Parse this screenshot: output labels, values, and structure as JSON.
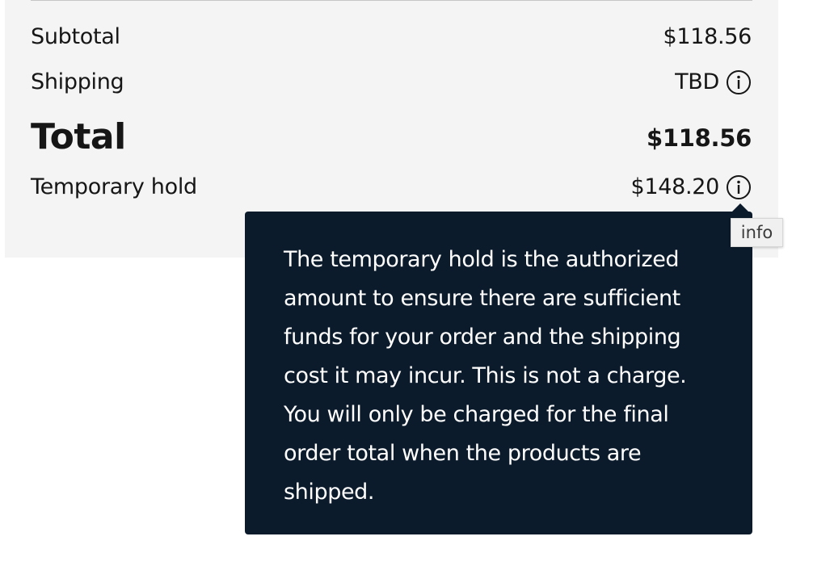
{
  "summary": {
    "subtotal_label": "Subtotal",
    "subtotal_value": "$118.56",
    "shipping_label": "Shipping",
    "shipping_value": "TBD",
    "total_label": "Total",
    "total_value": "$118.56",
    "hold_label": "Temporary hold",
    "hold_value": "$148.20"
  },
  "tooltip": {
    "lines": [
      "The temporary hold is the authorized",
      "amount to ensure there are sufficient",
      "funds for your order and the shipping",
      "cost it may incur. This is not a charge.",
      "You will only be charged for the final",
      "order total when the products are",
      "shipped."
    ]
  },
  "browser_tooltip": {
    "text": "info"
  },
  "icons": {
    "shipping_info": "info-icon",
    "hold_info": "info-icon"
  },
  "colors": {
    "panel_background": "#f4f4f4",
    "tooltip_background": "#0c1b2b",
    "text": "#161616"
  }
}
